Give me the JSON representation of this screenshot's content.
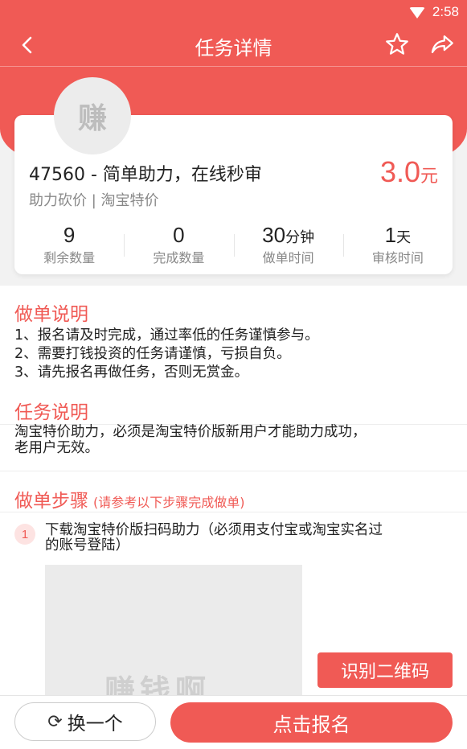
{
  "status": {
    "time": "2:58"
  },
  "nav": {
    "title": "任务详情"
  },
  "task": {
    "avatar_text": "赚",
    "title": "47560 - 简单助力，在线秒审",
    "tags": "助力砍价 | 淘宝特价",
    "price": "3.0",
    "price_unit": "元"
  },
  "stats": [
    {
      "value": "9",
      "unit": "",
      "label": "剩余数量"
    },
    {
      "value": "0",
      "unit": "",
      "label": "完成数量"
    },
    {
      "value": "30",
      "unit": "分钟",
      "label": "做单时间"
    },
    {
      "value": "1",
      "unit": "天",
      "label": "审核时间"
    }
  ],
  "instructions": {
    "title": "做单说明",
    "lines": [
      "1、报名请及时完成，通过率低的任务谨慎参与。",
      "2、需要打钱投资的任务请谨慎，亏损自负。",
      "3、请先报名再做任务，否则无赏金。"
    ]
  },
  "task_desc": {
    "title": "任务说明",
    "text_line1": "淘宝特价助力，必须是淘宝特价版新用户才能助力成功，",
    "text_line2": "老用户无效。"
  },
  "steps": {
    "title": "做单步骤",
    "hint": "(请参考以下步骤完成做单)",
    "items": [
      {
        "num": "1",
        "text_line1": "下载淘宝特价版扫码助力（必须用支付宝或淘宝实名过",
        "text_line2": "的账号登陆）",
        "image_watermark": "赚钱啊"
      }
    ],
    "qr_button": "识别二维码"
  },
  "bottom": {
    "swap_label": "换一个",
    "signup_label": "点击报名"
  }
}
